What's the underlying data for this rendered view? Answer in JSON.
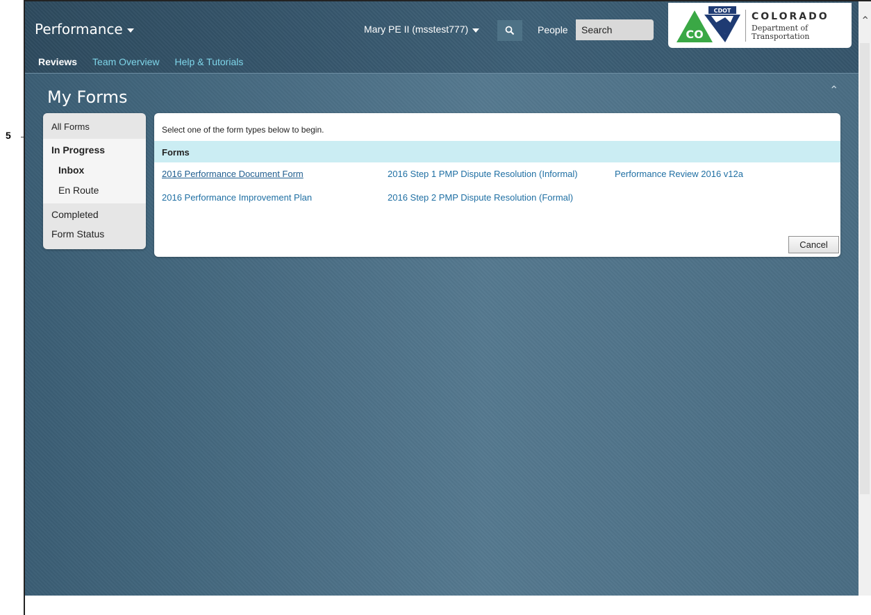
{
  "annotation": {
    "number": "5"
  },
  "header": {
    "app_title": "Performance",
    "nav": [
      "Reviews",
      "Team Overview",
      "Help & Tutorials"
    ],
    "user": "Mary PE II (msstest777)",
    "search_scope": "People",
    "search_placeholder": "Search"
  },
  "logo": {
    "badge": "CDOT",
    "state_abbrev": "CO",
    "title": "COLORADO",
    "subtitle": "Department of Transportation",
    "colors": {
      "green": "#3aa845",
      "navy": "#1f3b73"
    }
  },
  "page": {
    "title": "My Forms"
  },
  "sidebar": {
    "all_forms": "All Forms",
    "in_progress": "In Progress",
    "inbox": "Inbox",
    "en_route": "En Route",
    "completed": "Completed",
    "form_status": "Form Status"
  },
  "main": {
    "instructions": "Select one of the form types below to begin.",
    "forms_header": "Forms",
    "links": [
      "2016 Performance Document Form",
      "2016 Step 1 PMP Dispute Resolution (Informal)",
      "Performance Review 2016 v12a",
      "2016 Performance Improvement Plan",
      "2016 Step 2 PMP Dispute Resolution (Formal)"
    ],
    "cancel_label": "Cancel"
  }
}
